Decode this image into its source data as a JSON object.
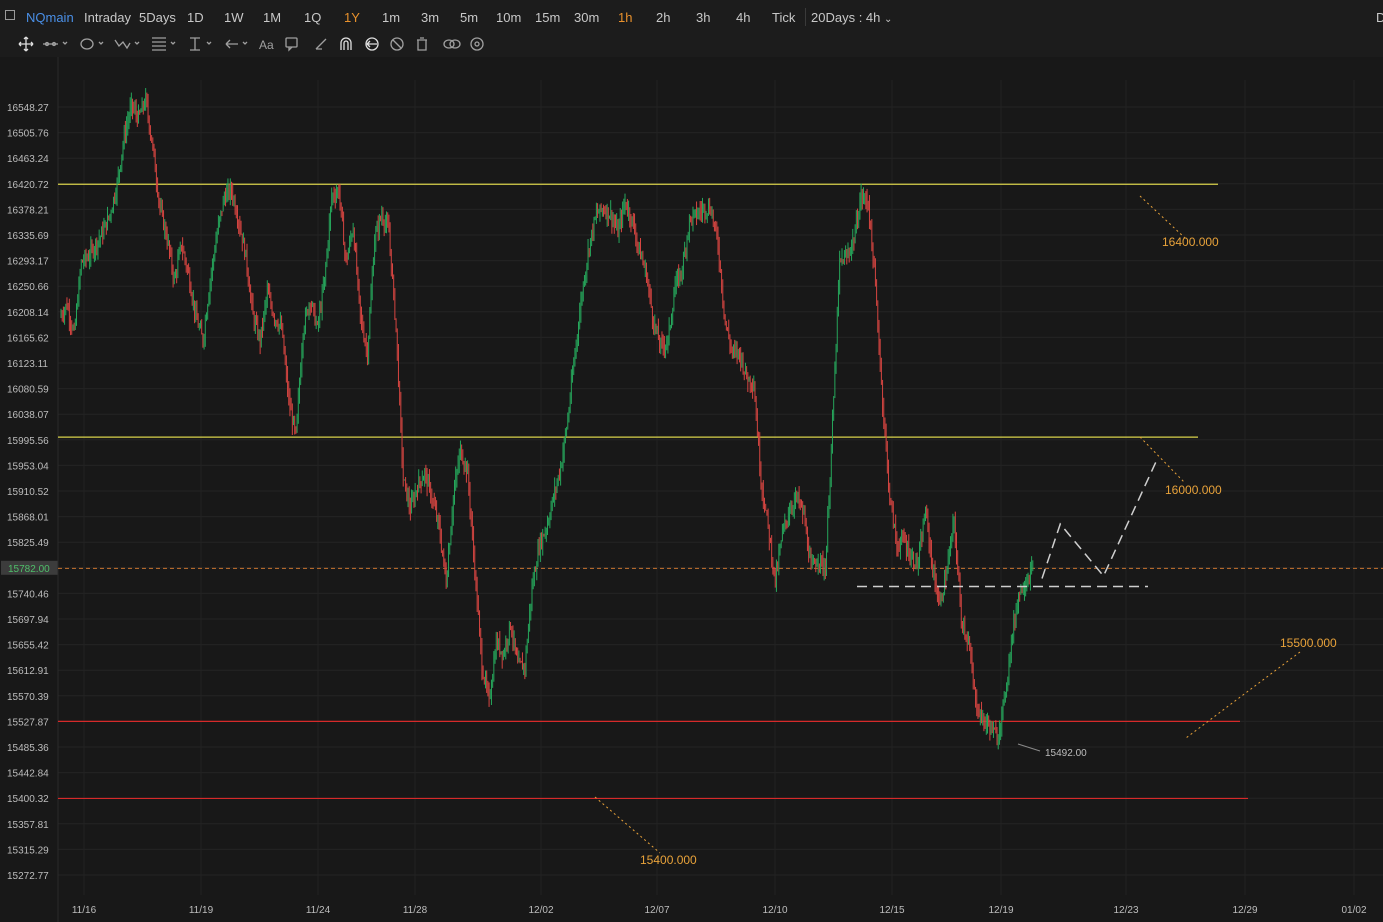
{
  "toolbar": {
    "symbol": "NQmain",
    "timeframes": [
      "Intraday",
      "5Days",
      "1D",
      "1W",
      "1M",
      "1Q",
      "1Y",
      "1m",
      "3m",
      "5m",
      "10m",
      "15m",
      "30m",
      "1h",
      "2h",
      "3h",
      "4h",
      "Tick"
    ],
    "active_timeframes": [
      "1Y",
      "1h"
    ],
    "range_label": "20Days : 4h",
    "right_label": "D"
  },
  "drawing_tools": [
    "move-icon",
    "line-tool-icon",
    "shape-tool-icon",
    "wave-tool-icon",
    "fib-tool-icon",
    "measure-tool-icon",
    "arrow-tool-icon",
    "text-tool-icon",
    "comment-tool-icon",
    "eraser-line-icon",
    "magnet-icon",
    "sync-icon",
    "hide-icon",
    "trash-icon",
    "link-icon",
    "settings-icon"
  ],
  "colors": {
    "up": "#26a65b",
    "down": "#d64541",
    "resistance": "#d9d24a",
    "support": "#d62a2a",
    "annotation": "#e8a23a",
    "current_price": "#c8732f",
    "projection": "#cfcfcf"
  },
  "chart_data": {
    "type": "candlestick",
    "title": "",
    "ylim": [
      15250,
      16580
    ],
    "y_ticks": [
      "16548.27",
      "16505.76",
      "16463.24",
      "16420.72",
      "16378.21",
      "16335.69",
      "16293.17",
      "16250.66",
      "16208.14",
      "16165.62",
      "16123.11",
      "16080.59",
      "16038.07",
      "15995.56",
      "15953.04",
      "15910.52",
      "15868.01",
      "15825.49",
      "15782.00",
      "15740.46",
      "15697.94",
      "15655.42",
      "15612.91",
      "15570.39",
      "15527.87",
      "15485.36",
      "15442.84",
      "15400.32",
      "15357.81",
      "15315.29",
      "15272.77"
    ],
    "x_ticks": [
      "11/16",
      "11/19",
      "11/24",
      "11/28",
      "12/02",
      "12/07",
      "12/10",
      "12/15",
      "12/19",
      "12/23",
      "12/29",
      "01/02"
    ],
    "current_price": "15782.00",
    "low_annotation": "15492.00",
    "levels": [
      {
        "value": 16420,
        "label": "16400.000",
        "kind": "resistance"
      },
      {
        "value": 16000,
        "label": "16000.000",
        "kind": "resistance"
      },
      {
        "value": 15528,
        "label": "15500.000",
        "kind": "support"
      },
      {
        "value": 15400,
        "label": "15400.000",
        "kind": "support"
      }
    ],
    "price_path": [
      16200,
      16220,
      16170,
      16290,
      16300,
      16320,
      16340,
      16370,
      16420,
      16500,
      16550,
      16530,
      16560,
      16480,
      16380,
      16330,
      16260,
      16320,
      16270,
      16200,
      16160,
      16260,
      16340,
      16400,
      16410,
      16360,
      16300,
      16200,
      16160,
      16240,
      16200,
      16180,
      16060,
      16000,
      16180,
      16230,
      16180,
      16260,
      16400,
      16410,
      16290,
      16350,
      16200,
      16140,
      16330,
      16370,
      16340,
      16180,
      15930,
      15880,
      15920,
      15940,
      15900,
      15850,
      15760,
      15900,
      15980,
      15940,
      15780,
      15620,
      15560,
      15660,
      15640,
      15690,
      15620,
      15620,
      15750,
      15820,
      15850,
      15900,
      15950,
      16030,
      16140,
      16240,
      16320,
      16370,
      16380,
      16370,
      16340,
      16390,
      16360,
      16310,
      16270,
      16190,
      16150,
      16160,
      16250,
      16280,
      16360,
      16370,
      16380,
      16380,
      16320,
      16190,
      16140,
      16140,
      16100,
      16090,
      15930,
      15850,
      15760,
      15840,
      15880,
      15900,
      15870,
      15780,
      15800,
      15780,
      16020,
      16290,
      16300,
      16330,
      16400,
      16390,
      16250,
      16060,
      15900,
      15820,
      15830,
      15800,
      15790,
      15880,
      15780,
      15720,
      15780,
      15860,
      15700,
      15660,
      15560,
      15530,
      15520,
      15500,
      15560,
      15660,
      15740,
      15760,
      15782
    ],
    "projection_x_dates": [
      "12/20",
      "12/21",
      "12/22"
    ],
    "consolidation_level": 15752
  }
}
